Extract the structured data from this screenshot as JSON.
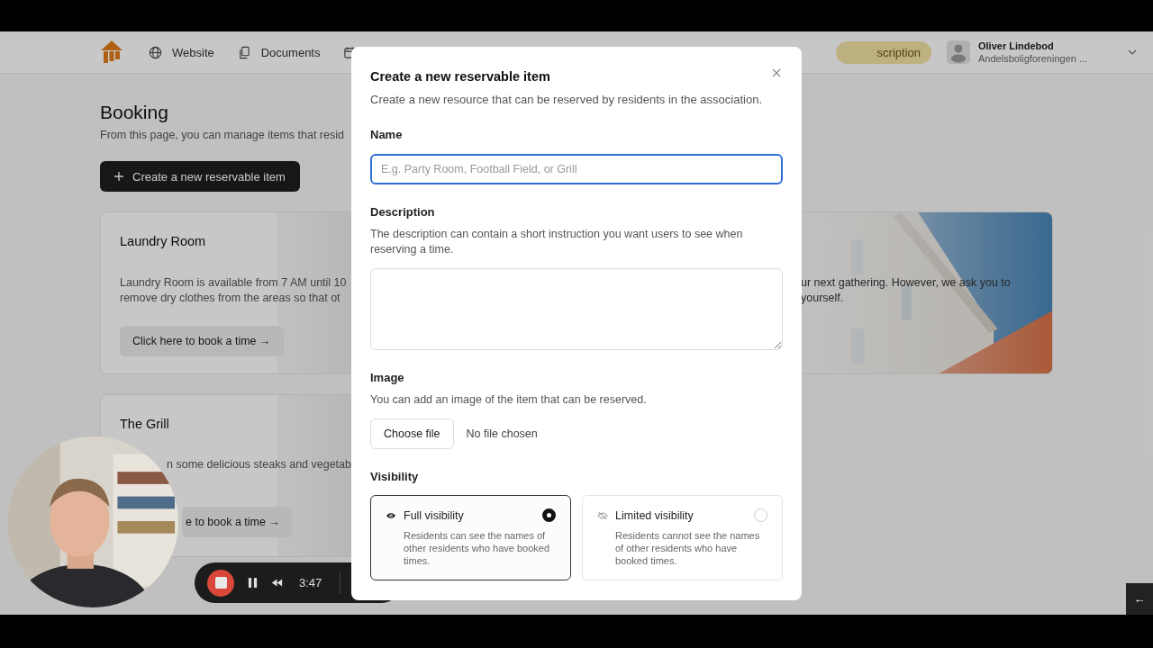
{
  "header": {
    "nav": [
      {
        "label": "Website"
      },
      {
        "label": "Documents"
      }
    ],
    "subscription_badge": "scription",
    "user": {
      "name": "Oliver Lindebod",
      "organization": "Andelsboligforeningen ..."
    }
  },
  "page": {
    "title": "Booking",
    "description": "From this page, you can manage items that resid",
    "create_button": "Create a new reservable item"
  },
  "cards": [
    {
      "title": "Laundry Room",
      "text": "Laundry Room is available from 7 AM until 10\nremove dry clothes from the areas so that ot",
      "button": "Click here to book a time →"
    },
    {
      "text": "ur next gathering. However, we ask you to\nyourself."
    },
    {
      "title": "The Grill",
      "text": "n some delicious steaks and vegetab",
      "button": "e to book a time →"
    }
  ],
  "dialog": {
    "title": "Create a new reservable item",
    "subtitle": "Create a new resource that can be reserved by residents in the association.",
    "fields": [
      {
        "kind": "text",
        "label": "Name",
        "placeholder": "E.g. Party Room, Football Field, or Grill"
      },
      {
        "kind": "textarea",
        "label": "Description",
        "help": "The description can contain a short instruction you want users to see when reserving a time."
      },
      {
        "kind": "file",
        "label": "Image",
        "help": "You can add an image of the item that can be reserved.",
        "button": "Choose file",
        "status": "No file chosen"
      },
      {
        "kind": "visibility",
        "label": "Visibility",
        "options": [
          {
            "title": "Full visibility",
            "description": "Residents can see the names of other residents who have booked times.",
            "selected": true
          },
          {
            "title": "Limited visibility",
            "description": "Residents cannot see the names of other residents who have booked times.",
            "selected": false
          }
        ]
      }
    ]
  },
  "recorder": {
    "time": "3:47"
  },
  "corner_button": "←"
}
